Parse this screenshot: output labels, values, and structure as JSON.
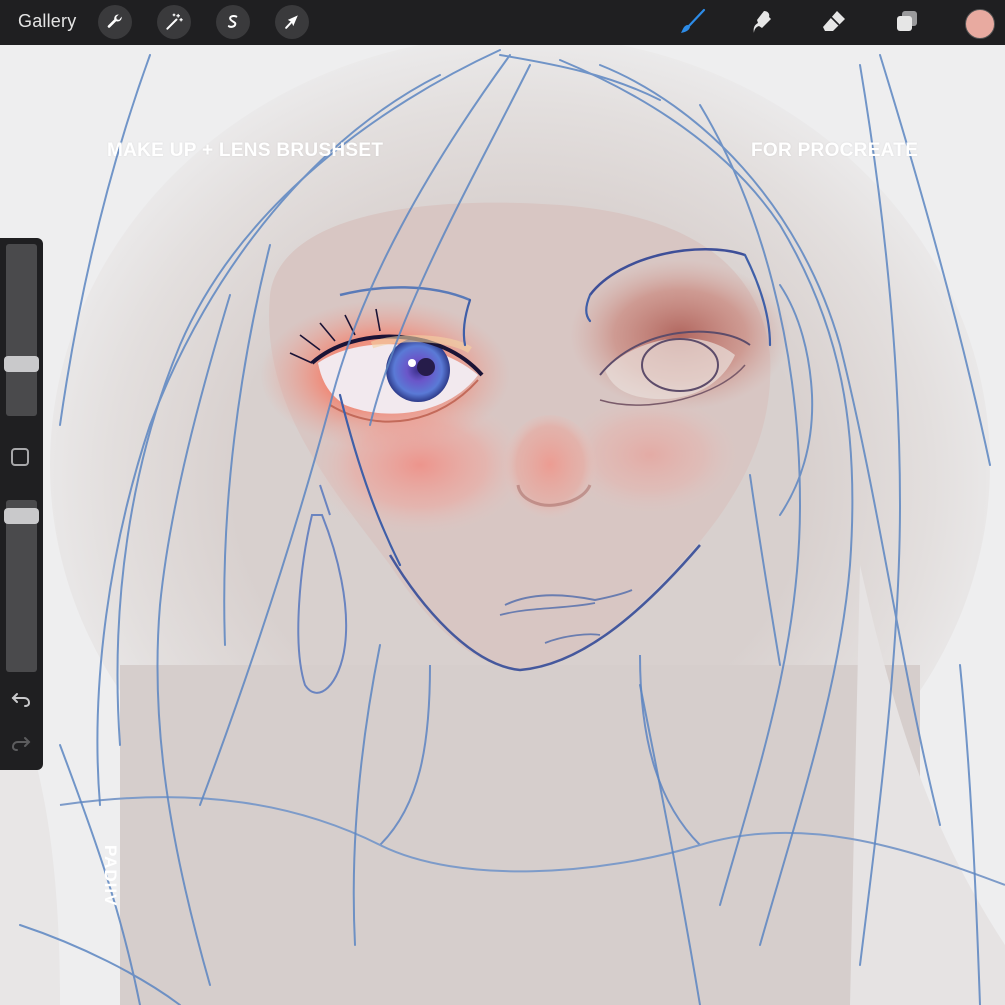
{
  "topbar": {
    "gallery_label": "Gallery",
    "left_tools": [
      {
        "icon": "wrench-icon",
        "name": "actions"
      },
      {
        "icon": "magic-wand-icon",
        "name": "adjustments"
      },
      {
        "icon": "selection-s-icon",
        "name": "selection"
      },
      {
        "icon": "arrow-cursor-icon",
        "name": "transform"
      }
    ],
    "right_tools": [
      {
        "icon": "brush-icon",
        "name": "paint",
        "active": true
      },
      {
        "icon": "smudge-icon",
        "name": "smudge"
      },
      {
        "icon": "eraser-icon",
        "name": "eraser"
      },
      {
        "icon": "layers-icon",
        "name": "layers"
      }
    ],
    "current_color": "#e8aaa0"
  },
  "canvas": {
    "title_left": "MAKE UP + LENS BRUSHSET",
    "title_right": "FOR PROCREATE",
    "signature": "PADIIV"
  },
  "sidebar": {
    "brush_size_level": 0.28,
    "opacity_level": 0.95,
    "modify_icon": "square-modify-icon",
    "undo_icon": "undo-icon",
    "redo_icon": "redo-icon"
  },
  "colors": {
    "toolbar_bg": "#1f1f21",
    "active_tool": "#2d8ce8",
    "sketch_line": "#5a86c2"
  }
}
